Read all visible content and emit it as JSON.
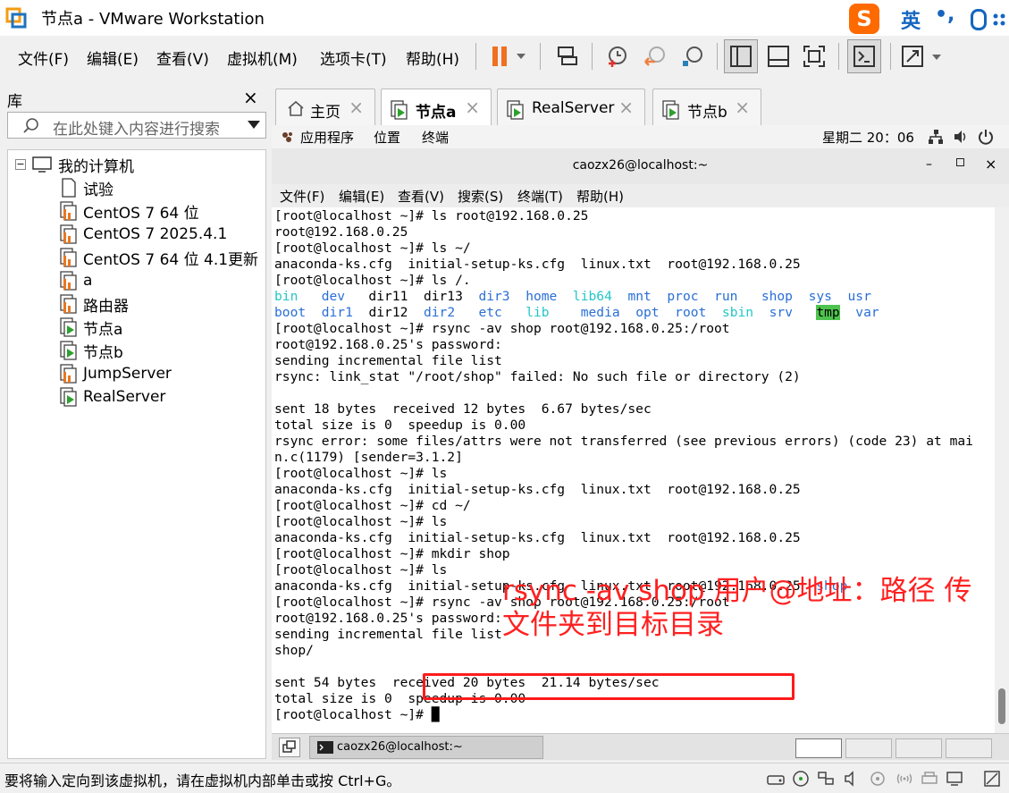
{
  "window": {
    "title": "节点a - VMware Workstation"
  },
  "ime": {
    "logo": "S",
    "lang": "英",
    "punct": "•,"
  },
  "menu": [
    {
      "label": "文件(F)"
    },
    {
      "label": "编辑(E)"
    },
    {
      "label": "查看(V)"
    },
    {
      "label": "虚拟机(M)"
    },
    {
      "label": "选项卡(T)"
    },
    {
      "label": "帮助(H)"
    }
  ],
  "library": {
    "title": "库",
    "close": "×",
    "search_placeholder": "在此处键入内容进行搜索",
    "root": "我的计算机",
    "items": [
      {
        "label": "试验",
        "kind": "doc"
      },
      {
        "label": "CentOS 7 64 位",
        "kind": "vm"
      },
      {
        "label": "CentOS 7 2025.4.1",
        "kind": "vm"
      },
      {
        "label": "CentOS 7 64 位 4.1更新",
        "kind": "vm"
      },
      {
        "label": "a",
        "kind": "vm"
      },
      {
        "label": "路由器",
        "kind": "vm"
      },
      {
        "label": "节点a",
        "kind": "vm-running"
      },
      {
        "label": "节点b",
        "kind": "vm-running"
      },
      {
        "label": "JumpServer",
        "kind": "vm"
      },
      {
        "label": "RealServer",
        "kind": "vm-running"
      }
    ]
  },
  "tabs": [
    {
      "label": "主页",
      "active": false
    },
    {
      "label": "节点a",
      "active": true
    },
    {
      "label": "RealServer",
      "active": false
    },
    {
      "label": "节点b",
      "active": false
    }
  ],
  "gnome": {
    "apps": "应用程序",
    "places": "位置",
    "terminal": "终端",
    "clock": "星期二 20：06"
  },
  "terminal": {
    "title": "caozx26@localhost:~",
    "menu": [
      "文件(F)",
      "编辑(E)",
      "查看(V)",
      "搜索(S)",
      "终端(T)",
      "帮助(H)"
    ],
    "lines": [
      [
        [
          "[root@localhost ~]# ls root@192.168.0.25",
          ""
        ]
      ],
      [
        [
          "root@192.168.0.25",
          ""
        ]
      ],
      [
        [
          "[root@localhost ~]# ls ~/",
          ""
        ]
      ],
      [
        [
          "anaconda-ks.cfg  initial-setup-ks.cfg  linux.txt  root@192.168.0.25",
          ""
        ]
      ],
      [
        [
          "[root@localhost ~]# ls /.",
          ""
        ]
      ],
      [
        [
          "bin",
          "cyan"
        ],
        [
          "   ",
          ""
        ],
        [
          "dev",
          "blue"
        ],
        [
          "   dir11  dir13  ",
          ""
        ],
        [
          "dir3",
          "blue"
        ],
        [
          "  ",
          ""
        ],
        [
          "home",
          "blue"
        ],
        [
          "  ",
          ""
        ],
        [
          "lib64",
          "cyan"
        ],
        [
          "  ",
          ""
        ],
        [
          "mnt",
          "blue"
        ],
        [
          "  ",
          ""
        ],
        [
          "proc",
          "blue"
        ],
        [
          "  ",
          ""
        ],
        [
          "run",
          "blue"
        ],
        [
          "   ",
          ""
        ],
        [
          "shop",
          "blue"
        ],
        [
          "  ",
          ""
        ],
        [
          "sys",
          "blue"
        ],
        [
          "  ",
          ""
        ],
        [
          "usr",
          "blue"
        ]
      ],
      [
        [
          "boot",
          "blue"
        ],
        [
          "  ",
          ""
        ],
        [
          "dir1",
          "blue"
        ],
        [
          "  dir12  ",
          ""
        ],
        [
          "dir2",
          "blue"
        ],
        [
          "   ",
          ""
        ],
        [
          "etc",
          "blue"
        ],
        [
          "   ",
          ""
        ],
        [
          "lib",
          "cyan"
        ],
        [
          "    ",
          ""
        ],
        [
          "media",
          "blue"
        ],
        [
          "  ",
          ""
        ],
        [
          "opt",
          "blue"
        ],
        [
          "  ",
          ""
        ],
        [
          "root",
          "blue"
        ],
        [
          "  ",
          ""
        ],
        [
          "sbin",
          "cyan"
        ],
        [
          "  ",
          ""
        ],
        [
          "srv",
          "blue"
        ],
        [
          "   ",
          ""
        ],
        [
          "tmp",
          "tmp"
        ],
        [
          "  ",
          ""
        ],
        [
          "var",
          "blue"
        ]
      ],
      [
        [
          "[root@localhost ~]# rsync -av shop root@192.168.0.25:/root",
          ""
        ]
      ],
      [
        [
          "root@192.168.0.25's password:",
          ""
        ]
      ],
      [
        [
          "sending incremental file list",
          ""
        ]
      ],
      [
        [
          "rsync: link_stat \"/root/shop\" failed: No such file or directory (2)",
          ""
        ]
      ],
      [
        [
          "",
          ""
        ]
      ],
      [
        [
          "sent 18 bytes  received 12 bytes  6.67 bytes/sec",
          ""
        ]
      ],
      [
        [
          "total size is 0  speedup is 0.00",
          ""
        ]
      ],
      [
        [
          "rsync error: some files/attrs were not transferred (see previous errors) (code 23) at mai",
          ""
        ]
      ],
      [
        [
          "n.c(1179) [sender=3.1.2]",
          ""
        ]
      ],
      [
        [
          "[root@localhost ~]# ls",
          ""
        ]
      ],
      [
        [
          "anaconda-ks.cfg  initial-setup-ks.cfg  linux.txt  root@192.168.0.25",
          ""
        ]
      ],
      [
        [
          "[root@localhost ~]# cd ~/",
          ""
        ]
      ],
      [
        [
          "[root@localhost ~]# ls",
          ""
        ]
      ],
      [
        [
          "anaconda-ks.cfg  initial-setup-ks.cfg  linux.txt  root@192.168.0.25",
          ""
        ]
      ],
      [
        [
          "[root@localhost ~]# mkdir shop",
          ""
        ]
      ],
      [
        [
          "[root@localhost ~]# ls",
          ""
        ]
      ],
      [
        [
          "anaconda-ks.cfg  initial-setup-ks.cfg  linux.txt  root@192.168.0.25  ",
          ""
        ],
        [
          "shop",
          "blue"
        ]
      ],
      [
        [
          "[root@localhost ~]# rsync -av shop root@192.168.0.25:/root",
          ""
        ]
      ],
      [
        [
          "root@192.168.0.25's password:",
          ""
        ]
      ],
      [
        [
          "sending incremental file list",
          ""
        ]
      ],
      [
        [
          "shop/",
          ""
        ]
      ],
      [
        [
          "",
          ""
        ]
      ],
      [
        [
          "sent 54 bytes  received 20 bytes  21.14 bytes/sec",
          ""
        ]
      ],
      [
        [
          "total size is 0  speedup is 0.00",
          ""
        ]
      ],
      [
        [
          "[root@localhost ~]# ",
          ""
        ],
        [
          "█",
          ""
        ]
      ]
    ]
  },
  "annotation": {
    "line1": "rsync -av shop 用户@地址：路径 传",
    "line2": "文件夹到目标目录"
  },
  "guest_taskbar": {
    "app": "caozx26@localhost:~"
  },
  "status": {
    "text": "要将输入定向到该虚拟机，请在虚拟机内部单击或按 Ctrl+G。"
  }
}
